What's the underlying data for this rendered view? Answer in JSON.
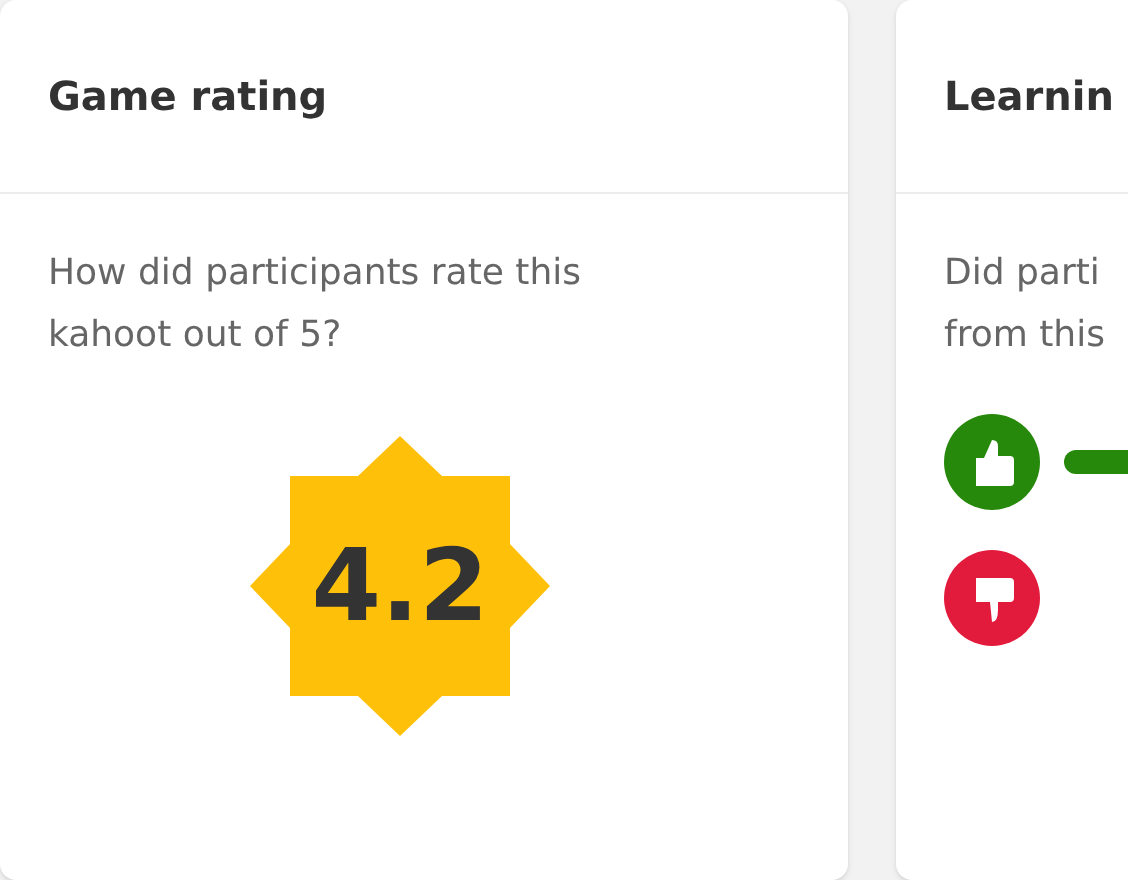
{
  "cards": [
    {
      "kind": "rating",
      "title": "Game rating",
      "question": "How did participants rate this kahoot out of 5?",
      "rating": "4.2"
    },
    {
      "kind": "learning",
      "title": "Learnin",
      "question_lines": [
        "Did parti",
        "from this"
      ]
    }
  ]
}
